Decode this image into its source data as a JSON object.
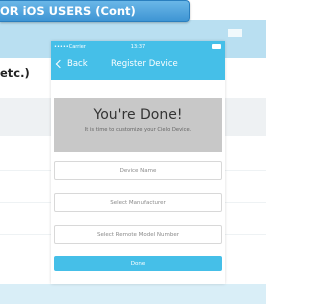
{
  "banner": {
    "text": "OR iOS USERS (Cont)"
  },
  "side_label": "etc.)",
  "phone": {
    "status": {
      "carrier": "•••••Carrier",
      "time": "13:37"
    },
    "nav": {
      "back_label": "Back",
      "title": "Register Device"
    },
    "done_panel": {
      "title": "You're Done!",
      "subtitle": "It is time to customize your Cielo Device."
    },
    "fields": [
      {
        "placeholder": "Device Name"
      },
      {
        "placeholder": "Select Manufacturer"
      },
      {
        "placeholder": "Select Remote Model Number"
      }
    ],
    "done_button": "Done"
  },
  "colors": {
    "accent": "#45bfe8",
    "banner": "#3f95d4",
    "panel": "#c8c8c8"
  }
}
